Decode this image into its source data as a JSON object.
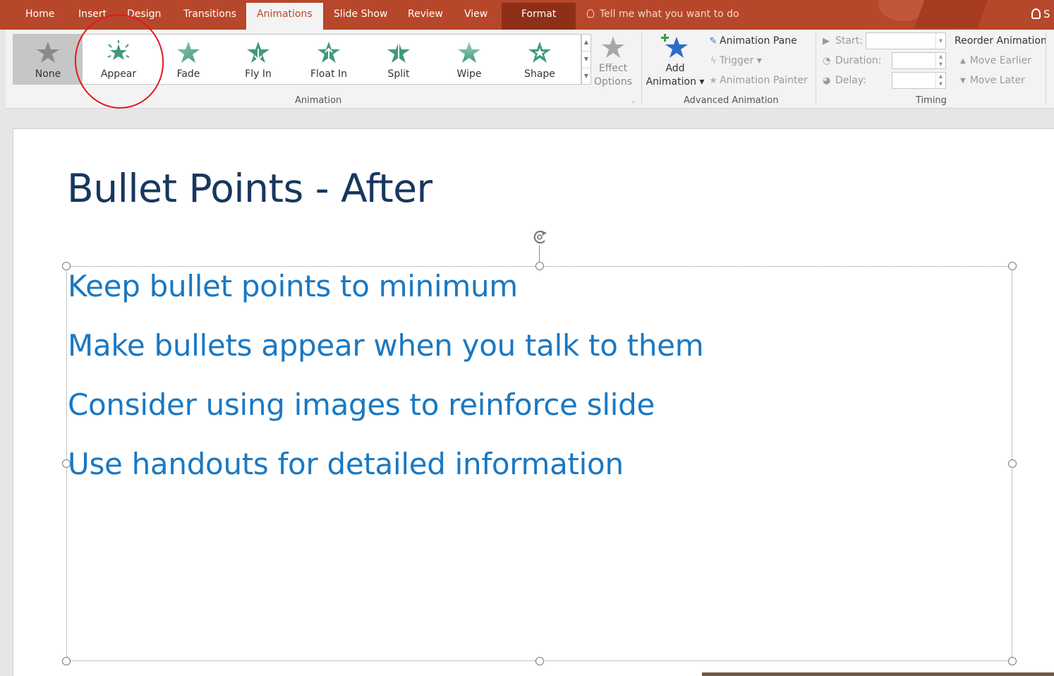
{
  "tabs": [
    {
      "label": "Home"
    },
    {
      "label": "Insert"
    },
    {
      "label": "Design"
    },
    {
      "label": "Transitions"
    },
    {
      "label": "Animations"
    },
    {
      "label": "Slide Show"
    },
    {
      "label": "Review"
    },
    {
      "label": "View"
    },
    {
      "label": "Format"
    }
  ],
  "active_tab": "Animations",
  "tell_me": "Tell me what you want to do",
  "signin_label": "S",
  "colors": {
    "accent": "#b7472a",
    "format_tab": "#8e2f18",
    "star_green": "#3f9a78",
    "slide_title": "#17375e",
    "bullet_text": "#1a78c2",
    "annotation": "#e0191f"
  },
  "gallery": {
    "items": [
      {
        "label": "None",
        "icon": "star-none-icon"
      },
      {
        "label": "Appear",
        "icon": "star-appear-icon"
      },
      {
        "label": "Fade",
        "icon": "star-fade-icon"
      },
      {
        "label": "Fly In",
        "icon": "star-flyin-icon"
      },
      {
        "label": "Float In",
        "icon": "star-floatin-icon"
      },
      {
        "label": "Split",
        "icon": "star-split-icon"
      },
      {
        "label": "Wipe",
        "icon": "star-wipe-icon"
      },
      {
        "label": "Shape",
        "icon": "star-shape-icon"
      }
    ],
    "selected": "None",
    "highlighted": "Appear"
  },
  "effect_options": {
    "line1": "Effect",
    "line2": "Options"
  },
  "groups": {
    "animation": "Animation",
    "advanced": "Advanced Animation",
    "timing": "Timing"
  },
  "advanced": {
    "add_line1": "Add",
    "add_line2": "Animation",
    "animation_pane": "Animation Pane",
    "trigger": "Trigger",
    "animation_painter": "Animation Painter"
  },
  "timing": {
    "start": "Start:",
    "duration": "Duration:",
    "delay": "Delay:"
  },
  "reorder": {
    "title": "Reorder Animation",
    "move_earlier": "Move Earlier",
    "move_later": "Move Later"
  },
  "slide": {
    "title": "Bullet Points - After",
    "bullets": [
      "Keep bullet points to minimum",
      "Make bullets appear when you talk to them",
      "Consider using images to reinforce slide",
      "Use handouts for detailed information"
    ]
  }
}
